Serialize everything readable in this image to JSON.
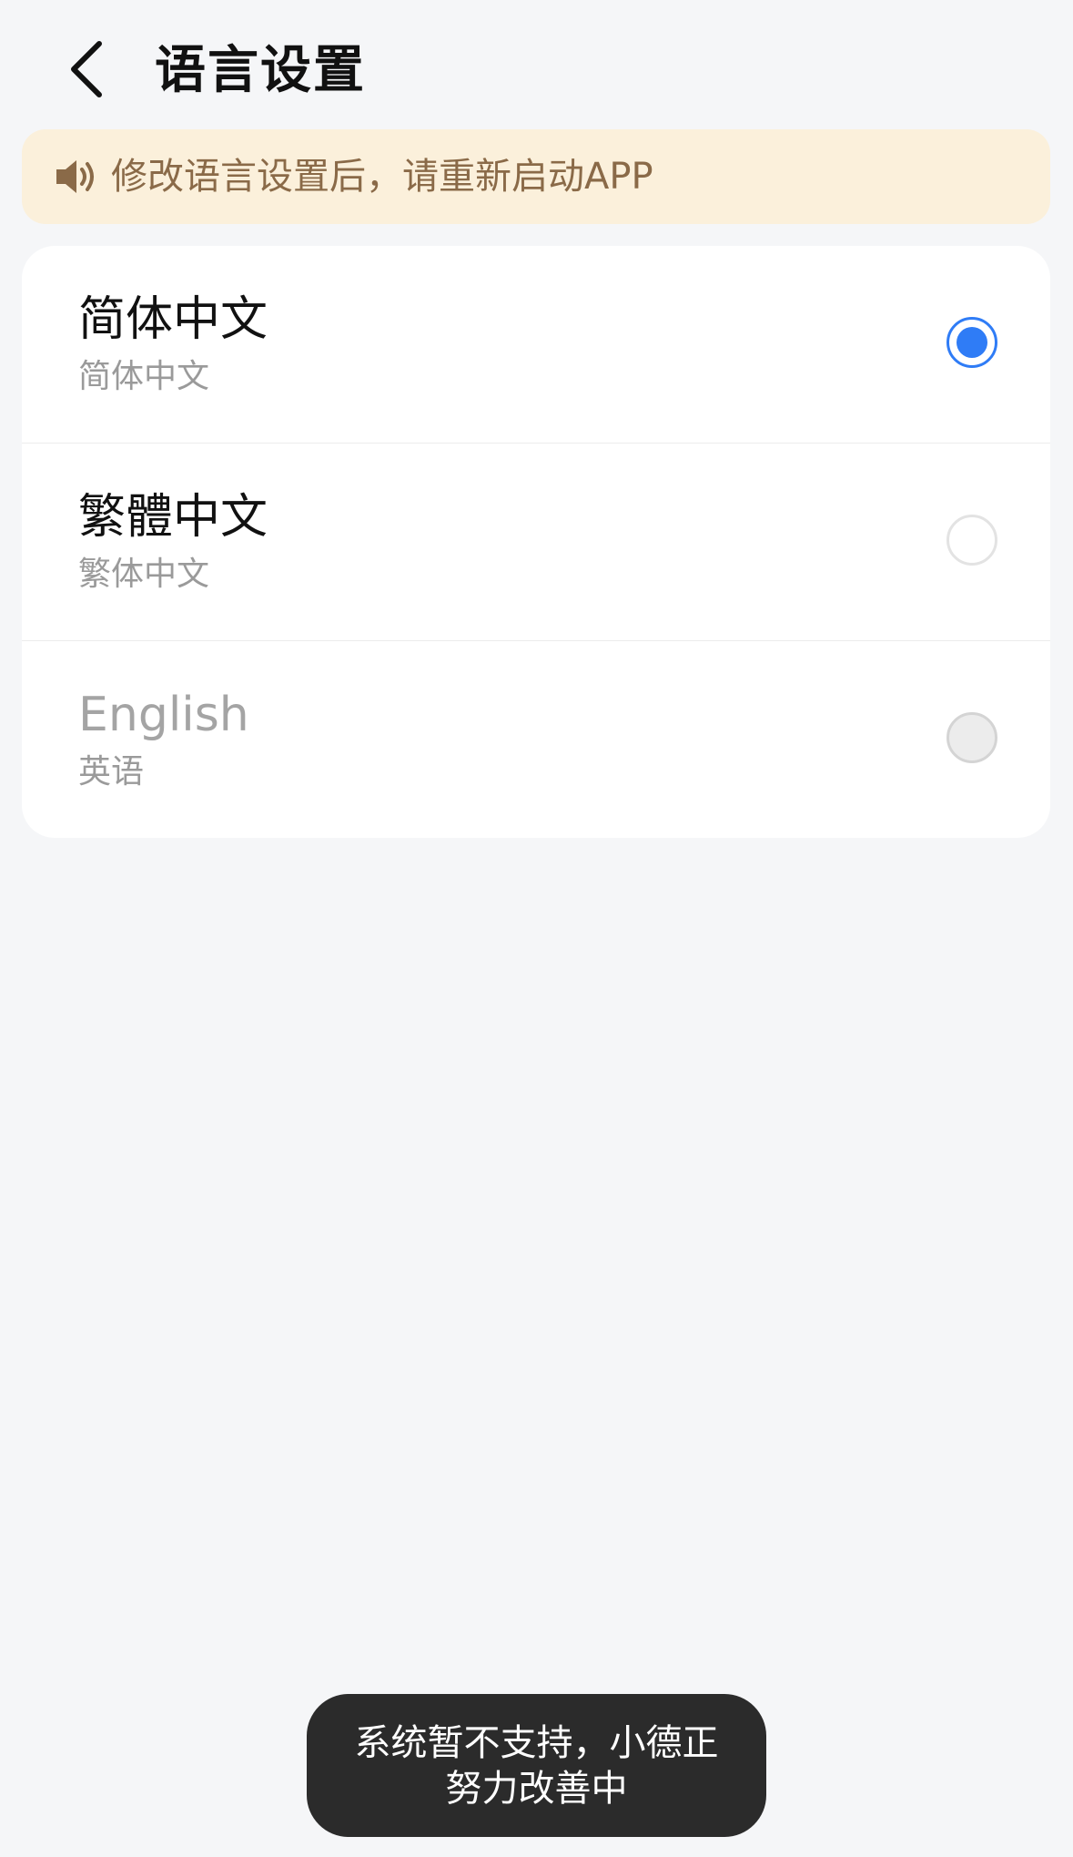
{
  "header": {
    "title": "语言设置"
  },
  "notice": {
    "text": "修改语言设置后，请重新启动APP"
  },
  "languages": [
    {
      "title": "简体中文",
      "subtitle": "简体中文",
      "selected": true,
      "disabled": false
    },
    {
      "title": "繁體中文",
      "subtitle": "繁体中文",
      "selected": false,
      "disabled": false
    },
    {
      "title": "English",
      "subtitle": "英语",
      "selected": false,
      "disabled": true
    }
  ],
  "toast": {
    "text": "系统暂不支持，小德正努力改善中"
  },
  "colors": {
    "accent": "#2f7cf6",
    "notice_bg": "#fbf0db",
    "notice_text": "#8a6a48",
    "toast_bg": "#2b2b2b",
    "page_bg": "#f5f6f8"
  },
  "icons": {
    "back": "chevron-left-icon",
    "notice": "speaker-icon"
  }
}
